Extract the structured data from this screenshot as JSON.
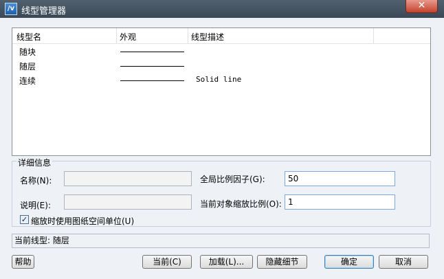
{
  "window": {
    "title": "线型管理器",
    "app_icon_glyph": "/v",
    "close_glyph": "✕"
  },
  "list": {
    "columns": [
      "线型名",
      "外观",
      "线型描述"
    ],
    "rows": [
      {
        "name": "随块",
        "description": ""
      },
      {
        "name": "随层",
        "description": ""
      },
      {
        "name": "连续",
        "description": "Solid line"
      }
    ]
  },
  "details": {
    "legend": "详细信息",
    "name_label": "名称(N):",
    "name_value": "",
    "desc_label": "说明(E):",
    "desc_value": "",
    "global_scale_label": "全局比例因子(G):",
    "global_scale_value": "50",
    "current_scale_label": "当前对象缩放比例(O):",
    "current_scale_value": "1",
    "paper_space_label": "缩放时使用图纸空间单位(U)",
    "paper_space_checked": true
  },
  "status": {
    "current_linetype": "当前线型: 随层"
  },
  "buttons": {
    "help": "帮助",
    "current": "当前(C)",
    "load": "加载(L)...",
    "hide_details": "隐藏细节",
    "ok": "确定",
    "cancel": "取消"
  }
}
